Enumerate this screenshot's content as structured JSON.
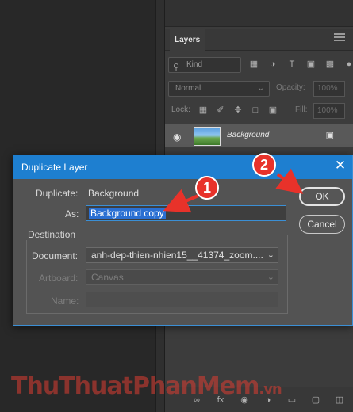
{
  "layers_panel": {
    "tab_label": "Layers",
    "filter": {
      "kind_label": "Kind",
      "filter_icons": [
        "image-filter-icon",
        "adjustment-filter-icon",
        "type-filter-icon",
        "shape-filter-icon",
        "smart-object-filter-icon",
        "toggle-filter-icon"
      ]
    },
    "blend_mode": "Normal",
    "opacity_label": "Opacity:",
    "opacity_value": "100%",
    "lock_label": "Lock:",
    "lock_icons": [
      "lock-transparent-pixels-icon",
      "lock-image-pixels-icon",
      "lock-position-icon",
      "lock-artboard-icon",
      "lock-all-icon"
    ],
    "fill_label": "Fill:",
    "fill_value": "100%",
    "layers": [
      {
        "name": "Background",
        "visible": true,
        "locked": true
      }
    ],
    "footer_icons": [
      "link-layers-icon",
      "fx-icon",
      "add-mask-icon",
      "adjustment-layer-icon",
      "new-group-icon",
      "new-layer-icon",
      "delete-layer-icon"
    ]
  },
  "dialog": {
    "title": "Duplicate Layer",
    "duplicate_label": "Duplicate:",
    "duplicate_value": "Background",
    "as_label": "As:",
    "as_value": "Background copy",
    "destination_label": "Destination",
    "document_label": "Document:",
    "document_value": "anh-dep-thien-nhien15__41374_zoom....",
    "artboard_label": "Artboard:",
    "artboard_value": "Canvas",
    "name_label": "Name:",
    "name_value": "",
    "ok_label": "OK",
    "cancel_label": "Cancel"
  },
  "callouts": {
    "step1": "1",
    "step2": "2",
    "color": "#e8322a"
  },
  "watermark": {
    "text": "ThuThuatPhanMem",
    "suffix": ".vn"
  },
  "colors": {
    "accent": "#1e7fd0",
    "dialog_bg": "#535353",
    "panel_bg": "#3c3c3c",
    "workspace_bg": "#282828"
  }
}
